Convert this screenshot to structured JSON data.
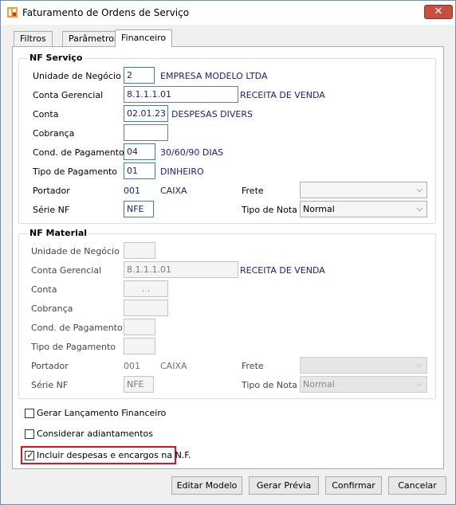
{
  "window": {
    "title": "Faturamento de Ordens de Serviço",
    "close_glyph": "✕"
  },
  "tabs": [
    {
      "label": "Filtros"
    },
    {
      "label": "Parâmetros"
    },
    {
      "label": "Financeiro"
    }
  ],
  "nf_servico": {
    "title": "NF Serviço",
    "unidade_label": "Unidade de Negócio",
    "unidade_value": "2",
    "unidade_desc": "EMPRESA MODELO LTDA",
    "conta_gerencial_label": "Conta Gerencial",
    "conta_gerencial_value": "8.1.1.1.01",
    "conta_gerencial_desc": "RECEITA DE VENDA",
    "conta_label": "Conta",
    "conta_value": "02.01.23",
    "conta_desc": "DESPESAS DIVERS",
    "cobranca_label": "Cobrança",
    "cobranca_value": "",
    "cond_pag_label": "Cond. de Pagamento",
    "cond_pag_value": "04",
    "cond_pag_desc": "30/60/90 DIAS",
    "tipo_pag_label": "Tipo de Pagamento",
    "tipo_pag_value": "01",
    "tipo_pag_desc": "DINHEIRO",
    "portador_label": "Portador",
    "portador_code": "001",
    "portador_desc": "CAIXA",
    "frete_label": "Frete",
    "frete_value": "",
    "serie_label": "Série NF",
    "serie_value": "NFE",
    "tipo_nota_label": "Tipo de Nota",
    "tipo_nota_value": "Normal"
  },
  "nf_material": {
    "title": "NF Material",
    "unidade_label": "Unidade de Negócio",
    "unidade_value": "",
    "conta_gerencial_label": "Conta Gerencial",
    "conta_gerencial_value": "8.1.1.1.01",
    "conta_gerencial_desc": "RECEITA DE VENDA",
    "conta_label": "Conta",
    "conta_value": ". .",
    "cobranca_label": "Cobrança",
    "cobranca_value": "",
    "cond_pag_label": "Cond. de Pagamento",
    "cond_pag_value": "",
    "tipo_pag_label": "Tipo de Pagamento",
    "tipo_pag_value": "",
    "portador_label": "Portador",
    "portador_code": "001",
    "portador_desc": "CAIXA",
    "frete_label": "Frete",
    "frete_value": "",
    "serie_label": "Série NF",
    "serie_value": "NFE",
    "tipo_nota_label": "Tipo de Nota",
    "tipo_nota_value": "Normal"
  },
  "options": {
    "gerar_lancamento": {
      "label": "Gerar Lançamento Financeiro",
      "checked": false
    },
    "considerar_adiantamentos": {
      "label": "Considerar adiantamentos",
      "checked": false
    },
    "incluir_despesas": {
      "label": "Incluir despesas e encargos na N.F.",
      "checked": true,
      "check_glyph": "✓"
    }
  },
  "buttons": {
    "editar_modelo": "Editar Modelo",
    "gerar_previa": "Gerar Prévia",
    "confirmar": "Confirmar",
    "cancelar": "Cancelar"
  },
  "icons": {
    "chevron": "⌵"
  },
  "colors": {
    "highlight": "#e0121f",
    "value_text": "#1a1a8c",
    "close_button": "#c74f42"
  }
}
